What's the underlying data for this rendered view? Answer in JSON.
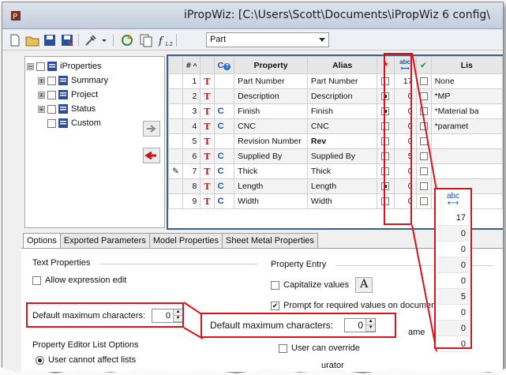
{
  "title": "iPropWiz: [C:\\Users\\Scott\\Documents\\iPropWiz 6 config\\",
  "toolbar": {
    "combo_value": "Part"
  },
  "tree": [
    {
      "label": "iProperties",
      "expander": "⊟"
    },
    {
      "label": "Summary",
      "expander": "⊞"
    },
    {
      "label": "Project",
      "expander": "⊞"
    },
    {
      "label": "Status",
      "expander": "⊞"
    },
    {
      "label": "Custom",
      "expander": ""
    }
  ],
  "grid": {
    "headers": {
      "num": "#",
      "co": "C",
      "property": "Property",
      "alias": "Alias",
      "required": "*",
      "maxlen": "abc",
      "list": "Lis"
    },
    "rows": [
      {
        "num": "1",
        "c": "",
        "property": "Part Number",
        "alias": "Part Number",
        "req": false,
        "maxlen": "17",
        "list_checked": false,
        "list": "None"
      },
      {
        "num": "2",
        "c": "",
        "property": "Description",
        "alias": "Description",
        "req": true,
        "maxlen": "0",
        "list_checked": false,
        "list": "*MP"
      },
      {
        "num": "3",
        "c": "C",
        "property": "Finish",
        "alias": "Finish",
        "req": true,
        "maxlen": "0",
        "list_checked": false,
        "list": "*Material ba"
      },
      {
        "num": "4",
        "c": "C",
        "property": "CNC",
        "alias": "CNC",
        "req": false,
        "maxlen": "0",
        "list_checked": false,
        "list": "*paramet"
      },
      {
        "num": "5",
        "c": "",
        "property": "Revision Number",
        "alias": "Rev",
        "req": false,
        "maxlen": "0",
        "list_checked": false,
        "list": ""
      },
      {
        "num": "6",
        "c": "C",
        "property": "Supplied By",
        "alias": "Supplied By",
        "req": false,
        "maxlen": "5",
        "list_checked": false,
        "list": ""
      },
      {
        "num": "7",
        "c": "C",
        "property": "Thick",
        "alias": "Thick",
        "req": false,
        "maxlen": "0",
        "list_checked": false,
        "list": ""
      },
      {
        "num": "8",
        "c": "C",
        "property": "Length",
        "alias": "Length",
        "req": true,
        "maxlen": "0",
        "list_checked": false,
        "list": ""
      },
      {
        "num": "9",
        "c": "C",
        "property": "Width",
        "alias": "Width",
        "req": false,
        "maxlen": "0",
        "list_checked": false,
        "list": ""
      }
    ]
  },
  "tabs": [
    "Options",
    "Exported Parameters",
    "Model Properties",
    "Sheet Metal Properties"
  ],
  "options": {
    "text_properties": "Text Properties",
    "allow_expression_edit": "Allow expression edit",
    "default_max_chars_label": "Default maximum characters:",
    "default_max_chars_value": "0",
    "list_options": "Property Editor List Options",
    "user_cannot_affect": "User cannot affect lists",
    "property_entry": "Property Entry",
    "capitalize_values": "Capitalize values",
    "prompt_required": "Prompt for required values on document c",
    "same_suffix": "ame",
    "user_can_override": "User can override",
    "configurator": "urator"
  },
  "callout": {
    "label": "Default maximum characters:",
    "value": "0"
  },
  "zoom": {
    "header": "abc",
    "values": [
      "17",
      "0",
      "0",
      "0",
      "0",
      "5",
      "0",
      "0",
      "0"
    ]
  },
  "colors": {
    "highlight": "#d9121b",
    "grid_border": "#3a5f88",
    "title_bg": "#c3cedd"
  }
}
